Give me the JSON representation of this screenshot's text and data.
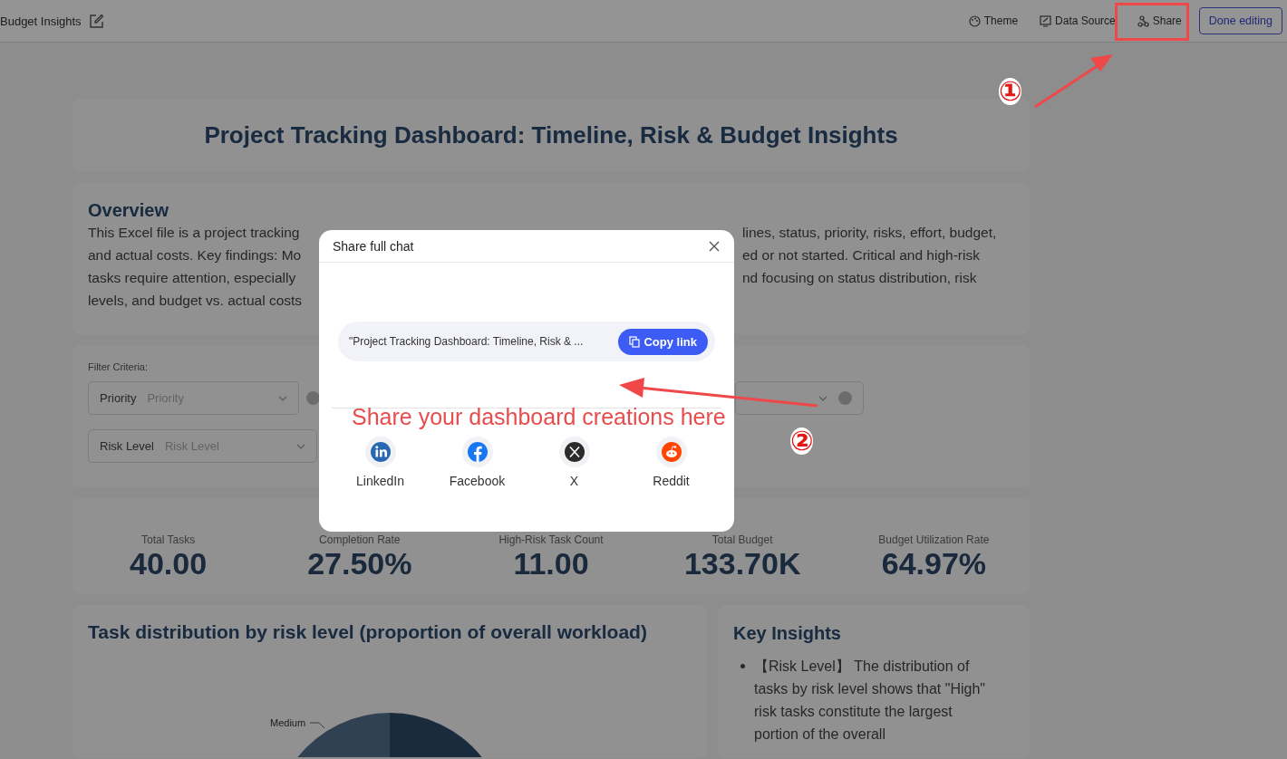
{
  "toolbar": {
    "title": "Budget Insights",
    "actions": [
      {
        "kind": "theme",
        "label": "Theme"
      },
      {
        "kind": "data",
        "label": "Data Source"
      },
      {
        "kind": "share",
        "label": "Share"
      }
    ],
    "done_button": "Done editing"
  },
  "dashboard": {
    "title": "Project Tracking Dashboard: Timeline, Risk & Budget Insights",
    "overview": {
      "heading": "Overview",
      "left_lines": [
        "This Excel file is a project tracking",
        "and actual costs. Key findings: Mo",
        "tasks require attention, especially",
        "levels, and budget vs. actual costs"
      ],
      "right_lines": [
        "lines, status, priority, risks, effort, budget,",
        "ed or not started. Critical and high-risk",
        "nd focusing on status distribution, risk"
      ]
    },
    "filters": {
      "label": "Filter Criteria:",
      "selects": [
        {
          "kind": "select",
          "label": "Priority",
          "placeholder": "Priority"
        },
        {
          "kind": "select"
        },
        {
          "kind": "select",
          "label": "Risk Level",
          "placeholder": "Risk Level"
        }
      ]
    },
    "kpis": [
      {
        "label": "Total Tasks",
        "value": "40.00"
      },
      {
        "label": "Completion Rate",
        "value": "27.50%"
      },
      {
        "label": "High-Risk Task Count",
        "value": "11.00"
      },
      {
        "label": "Total Budget",
        "value": "133.70K"
      },
      {
        "label": "Budget Utilization Rate",
        "value": "64.97%"
      }
    ],
    "chart": {
      "title": "Task distribution by risk level (proportion of overall workload)",
      "slice_label": "Medium"
    },
    "insights": {
      "heading": "Key Insights",
      "items": [
        "【Risk Level】 The distribution of tasks by risk level shows that \"High\" risk tasks constitute the largest portion of the overall"
      ]
    }
  },
  "dialog": {
    "title": "Share full chat",
    "link_text": "\"Project Tracking Dashboard: Timeline, Risk & ...",
    "copy_button": "Copy link",
    "networks": [
      {
        "kind": "linkedin",
        "label": "LinkedIn"
      },
      {
        "kind": "facebook",
        "label": "Facebook"
      },
      {
        "kind": "x",
        "label": "X"
      },
      {
        "kind": "reddit",
        "label": "Reddit"
      }
    ]
  },
  "annotations": {
    "markers": [
      "①",
      "②"
    ],
    "callout": "Share your dashboard creations here"
  }
}
